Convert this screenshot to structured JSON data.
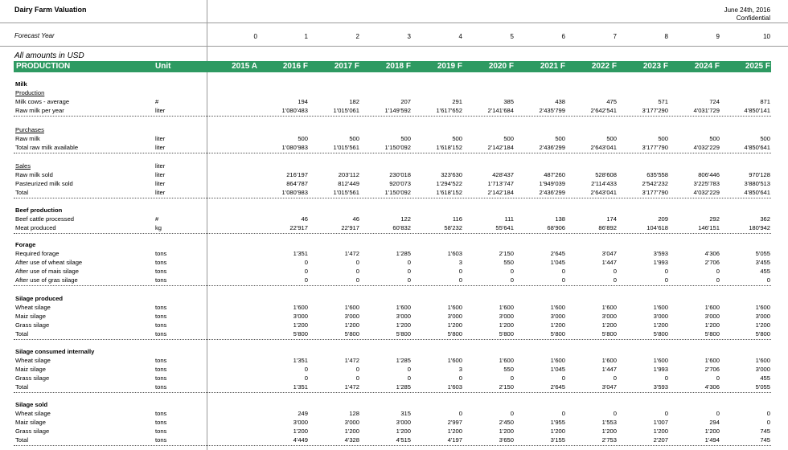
{
  "title": "Dairy Farm Valuation",
  "date": "June 24th, 2016",
  "confidential": "Confidential",
  "forecast_label": "Forecast Year",
  "forecast_years": [
    "0",
    "1",
    "2",
    "3",
    "4",
    "5",
    "6",
    "7",
    "8",
    "9",
    "10"
  ],
  "amounts_note": "All amounts in USD",
  "header": {
    "section": "PRODUCTION",
    "unit": "Unit",
    "years": [
      "2015 A",
      "2016 F",
      "2017 F",
      "2018 F",
      "2019 F",
      "2020 F",
      "2021 F",
      "2022 F",
      "2023 F",
      "2024 F",
      "2025 F"
    ]
  },
  "colors": {
    "header_bg": "#2e9a62",
    "header_text": "#ffffff"
  },
  "sections": [
    {
      "rows": [
        {
          "label": "Milk",
          "style": "b"
        },
        {
          "label": "Production",
          "style": "u"
        },
        {
          "label": "Milk cows - average",
          "unit": "#",
          "values": [
            "",
            "194",
            "182",
            "207",
            "291",
            "385",
            "438",
            "475",
            "571",
            "724",
            "871"
          ]
        },
        {
          "label": "Raw milk per year",
          "unit": "liter",
          "values": [
            "",
            "1'080'483",
            "1'015'061",
            "1'149'592",
            "1'617'652",
            "2'141'684",
            "2'435'799",
            "2'642'541",
            "3'177'290",
            "4'031'729",
            "4'850'141"
          ]
        }
      ]
    },
    {
      "rows": [
        {
          "label": "Purchases",
          "style": "u"
        },
        {
          "label": "Raw milk",
          "unit": "liter",
          "values": [
            "",
            "500",
            "500",
            "500",
            "500",
            "500",
            "500",
            "500",
            "500",
            "500",
            "500"
          ]
        },
        {
          "label": "Total raw milk available",
          "unit": "liter",
          "values": [
            "",
            "1'080'983",
            "1'015'561",
            "1'150'092",
            "1'618'152",
            "2'142'184",
            "2'436'299",
            "2'643'041",
            "3'177'790",
            "4'032'229",
            "4'850'641"
          ]
        }
      ]
    },
    {
      "rows": [
        {
          "label": "Sales",
          "style": "u",
          "unit": "liter"
        },
        {
          "label": "Raw milk sold",
          "unit": "liter",
          "values": [
            "",
            "216'197",
            "203'112",
            "230'018",
            "323'630",
            "428'437",
            "487'260",
            "528'608",
            "635'558",
            "806'446",
            "970'128"
          ]
        },
        {
          "label": "Pasteurized milk sold",
          "unit": "liter",
          "values": [
            "",
            "864'787",
            "812'449",
            "920'073",
            "1'294'522",
            "1'713'747",
            "1'949'039",
            "2'114'433",
            "2'542'232",
            "3'225'783",
            "3'880'513"
          ]
        },
        {
          "label": "Total",
          "unit": "liter",
          "values": [
            "",
            "1'080'983",
            "1'015'561",
            "1'150'092",
            "1'618'152",
            "2'142'184",
            "2'436'299",
            "2'643'041",
            "3'177'790",
            "4'032'229",
            "4'850'641"
          ]
        }
      ]
    },
    {
      "rows": [
        {
          "label": "Beef production",
          "style": "b"
        },
        {
          "label": "Beef cattle processed",
          "unit": "#",
          "values": [
            "",
            "46",
            "46",
            "122",
            "116",
            "111",
            "138",
            "174",
            "209",
            "292",
            "362"
          ]
        },
        {
          "label": "Meat produced",
          "unit": "kg",
          "values": [
            "",
            "22'917",
            "22'917",
            "60'832",
            "58'232",
            "55'641",
            "68'906",
            "86'892",
            "104'618",
            "146'151",
            "180'942"
          ]
        }
      ]
    },
    {
      "rows": [
        {
          "label": "Forage",
          "style": "b"
        },
        {
          "label": "Required forage",
          "unit": "tons",
          "values": [
            "",
            "1'351",
            "1'472",
            "1'285",
            "1'603",
            "2'150",
            "2'645",
            "3'047",
            "3'593",
            "4'306",
            "5'055"
          ]
        },
        {
          "label": "After use of wheat silage",
          "unit": "tons",
          "values": [
            "",
            "0",
            "0",
            "0",
            "3",
            "550",
            "1'045",
            "1'447",
            "1'993",
            "2'706",
            "3'455"
          ]
        },
        {
          "label": "After use of mais silage",
          "unit": "tons",
          "values": [
            "",
            "0",
            "0",
            "0",
            "0",
            "0",
            "0",
            "0",
            "0",
            "0",
            "455"
          ]
        },
        {
          "label": "After use of gras silage",
          "unit": "tons",
          "values": [
            "",
            "0",
            "0",
            "0",
            "0",
            "0",
            "0",
            "0",
            "0",
            "0",
            "0"
          ]
        }
      ]
    },
    {
      "rows": [
        {
          "label": "Silage produced",
          "style": "b"
        },
        {
          "label": "Wheat silage",
          "unit": "tons",
          "values": [
            "",
            "1'600",
            "1'600",
            "1'600",
            "1'600",
            "1'600",
            "1'600",
            "1'600",
            "1'600",
            "1'600",
            "1'600"
          ]
        },
        {
          "label": "Maiz silage",
          "unit": "tons",
          "values": [
            "",
            "3'000",
            "3'000",
            "3'000",
            "3'000",
            "3'000",
            "3'000",
            "3'000",
            "3'000",
            "3'000",
            "3'000"
          ]
        },
        {
          "label": "Grass silage",
          "unit": "tons",
          "values": [
            "",
            "1'200",
            "1'200",
            "1'200",
            "1'200",
            "1'200",
            "1'200",
            "1'200",
            "1'200",
            "1'200",
            "1'200"
          ]
        },
        {
          "label": "Total",
          "unit": "tons",
          "values": [
            "",
            "5'800",
            "5'800",
            "5'800",
            "5'800",
            "5'800",
            "5'800",
            "5'800",
            "5'800",
            "5'800",
            "5'800"
          ]
        }
      ]
    },
    {
      "rows": [
        {
          "label": "Silage consumed internally",
          "style": "b"
        },
        {
          "label": "Wheat silage",
          "unit": "tons",
          "values": [
            "",
            "1'351",
            "1'472",
            "1'285",
            "1'600",
            "1'600",
            "1'600",
            "1'600",
            "1'600",
            "1'600",
            "1'600"
          ]
        },
        {
          "label": "Maiz silage",
          "unit": "tons",
          "values": [
            "",
            "0",
            "0",
            "0",
            "3",
            "550",
            "1'045",
            "1'447",
            "1'993",
            "2'706",
            "3'000"
          ]
        },
        {
          "label": "Grass silage",
          "unit": "tons",
          "values": [
            "",
            "0",
            "0",
            "0",
            "0",
            "0",
            "0",
            "0",
            "0",
            "0",
            "455"
          ]
        },
        {
          "label": "Total",
          "unit": "tons",
          "values": [
            "",
            "1'351",
            "1'472",
            "1'285",
            "1'603",
            "2'150",
            "2'645",
            "3'047",
            "3'593",
            "4'306",
            "5'055"
          ]
        }
      ]
    },
    {
      "rows": [
        {
          "label": "Silage sold",
          "style": "b"
        },
        {
          "label": "Wheat silage",
          "unit": "tons",
          "values": [
            "",
            "249",
            "128",
            "315",
            "0",
            "0",
            "0",
            "0",
            "0",
            "0",
            "0"
          ]
        },
        {
          "label": "Maiz silage",
          "unit": "tons",
          "values": [
            "",
            "3'000",
            "3'000",
            "3'000",
            "2'997",
            "2'450",
            "1'955",
            "1'553",
            "1'007",
            "294",
            "0"
          ]
        },
        {
          "label": "Grass silage",
          "unit": "tons",
          "values": [
            "",
            "1'200",
            "1'200",
            "1'200",
            "1'200",
            "1'200",
            "1'200",
            "1'200",
            "1'200",
            "1'200",
            "745"
          ]
        },
        {
          "label": "Total",
          "unit": "tons",
          "values": [
            "",
            "4'449",
            "4'328",
            "4'515",
            "4'197",
            "3'650",
            "3'155",
            "2'753",
            "2'207",
            "1'494",
            "745"
          ]
        }
      ]
    }
  ]
}
